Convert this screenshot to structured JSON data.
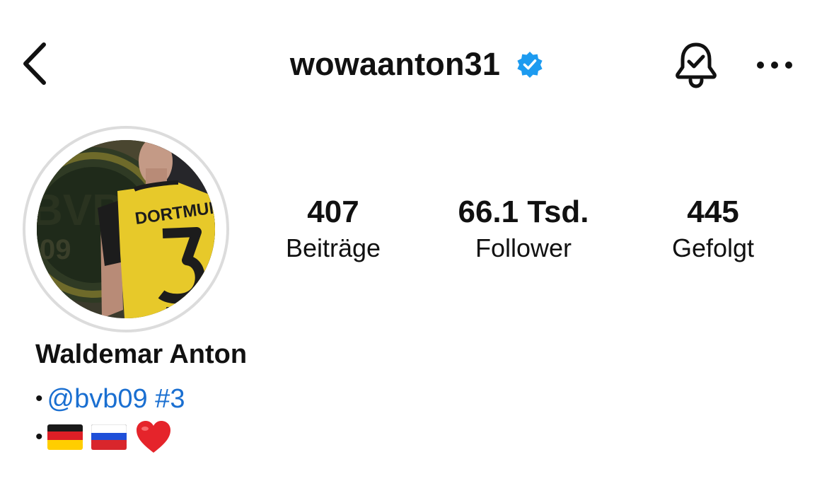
{
  "header": {
    "username": "wowaanton31",
    "verified": true,
    "icons": [
      "chevron-left-icon",
      "verified-badge-icon",
      "bell-check-icon",
      "more-horizontal-icon"
    ]
  },
  "stats": {
    "posts": {
      "value": "407",
      "label": "Beiträge"
    },
    "followers": {
      "value": "66.1 Tsd.",
      "label": "Follower"
    },
    "following": {
      "value": "445",
      "label": "Gefolgt"
    }
  },
  "profile": {
    "display_name": "Waldemar Anton",
    "bio": {
      "bullet": "•",
      "mention": "@bvb09 #3",
      "flags": [
        "germany-flag",
        "russia-flag",
        "red-heart"
      ]
    }
  },
  "colors": {
    "accent_blue": "#1a6fd1",
    "verified_blue": "#1d9bf0",
    "text": "#111111",
    "ring": "#dcdcdc"
  }
}
